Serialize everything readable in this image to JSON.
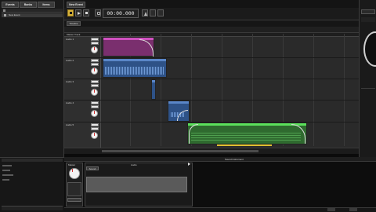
{
  "left_panel": {
    "tabs": [
      "Events",
      "Banks",
      "Items"
    ],
    "selected_event": "New Event",
    "bottom_status": "",
    "bottom_right": ""
  },
  "transport": {
    "tab_label": "New Event",
    "time_display": "00:00.000",
    "subtab": "Timeline"
  },
  "timeline": {
    "master_label": "Master Track",
    "tracks": [
      {
        "name": "Audio 1",
        "color": "#b03a9e"
      },
      {
        "name": "Audio 2",
        "color": "#3f6fb4"
      },
      {
        "name": "Audio 3",
        "color": "#3f6fb4"
      },
      {
        "name": "Audio 4",
        "color": "#3f6fb4"
      },
      {
        "name": "Audio 5",
        "color": "#3fb43f"
      }
    ]
  },
  "deck": {
    "title": "Sound Instrument",
    "master_label": "Master",
    "audio_label": "Audio",
    "sub_label": "Sound",
    "filename": "",
    "time_readout": "",
    "zoom": ""
  },
  "statusbar": {
    "text": ""
  },
  "colors": {
    "magenta_region": "#b03a9e",
    "blue_region": "#3f6fb4",
    "green_region": "#3fb43f",
    "accent_yellow": "#e0c030"
  }
}
